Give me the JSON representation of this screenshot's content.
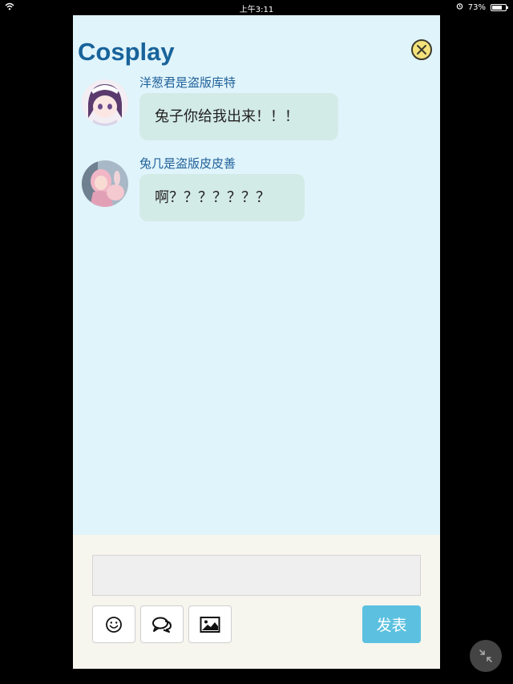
{
  "status_bar": {
    "time": "上午3:11",
    "battery": "73%",
    "battery_level": 0.73
  },
  "chat": {
    "title": "Cosplay",
    "messages": [
      {
        "username": "洋葱君是盗版库特",
        "text": "兔子你给我出来！！！"
      },
      {
        "username": "兔几是盗版皮皮善",
        "text": "啊？？？？？？？"
      }
    ]
  },
  "composer": {
    "input_value": "",
    "tools": [
      "emoji-icon",
      "chat-bubbles-icon",
      "image-icon"
    ],
    "post_label": "发表"
  },
  "colors": {
    "panel_bg": "#e0f4fb",
    "title": "#18639a",
    "bubble": "#d3ebe7",
    "post_button": "#5cc1e0",
    "close_button": "#f4e27b"
  }
}
